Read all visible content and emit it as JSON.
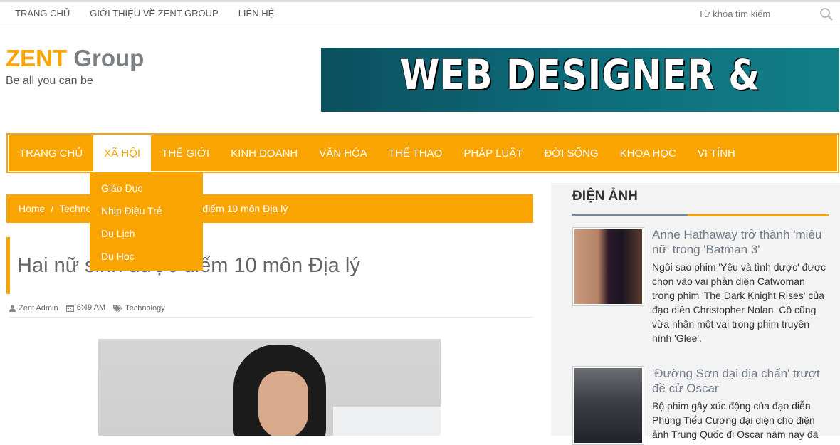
{
  "topbar": {
    "links": [
      "TRANG CHỦ",
      "GIỚI THIỆU VỀ ZENT GROUP",
      "LIÊN HỆ"
    ],
    "search_placeholder": "Từ khóa tìm kiếm"
  },
  "brand": {
    "logo_part1": "ZENT",
    "logo_part2": "Group",
    "tagline": "Be all you can be"
  },
  "banner": {
    "text": "WEB DESIGNER & DEVELOPER"
  },
  "mainnav": {
    "items": [
      "TRANG CHỦ",
      "XÃ HỘI",
      "THẾ GIỚI",
      "KINH DOANH",
      "VĂN HÓA",
      "THỂ THAO",
      "PHÁP LUẬT",
      "ĐỜI SỐNG",
      "KHOA HỌC",
      "VI TÍNH"
    ],
    "active_index": 1,
    "dropdown": [
      "Giáo Dục",
      "Nhịp Điệu Trẻ",
      "Du Lịch",
      "Du Học"
    ]
  },
  "breadcrumb": {
    "home": "Home",
    "category": "Technology",
    "current": "Hai nữ sinh được điểm 10 môn Địa lý",
    "visible_category": "Techno",
    "visible_current": "điểm 10 môn Địa lý"
  },
  "post": {
    "title": "Hai nữ sinh được điểm 10 môn Địa lý",
    "author": "Zent Admin",
    "time": "6:49 AM",
    "category": "Technology"
  },
  "sidebar": {
    "widget_title": "ĐIỆN ẢNH",
    "items": [
      {
        "title": "Anne Hathaway trở thành 'miêu nữ' trong 'Batman 3'",
        "desc": "Ngôi sao phim 'Yêu và tình dược' được chọn vào vai phản diện Catwoman trong phim 'The Dark Knight Rises' của đạo diễn Christopher Nolan. Cô cũng vừa nhận một vai trong phim truyền hình 'Glee'."
      },
      {
        "title": "'Đường Sơn đại địa chấn' trượt đề cử Oscar",
        "desc": "Bộ phim gây xúc động của đạo diễn Phùng Tiểu Cương đại diện cho điện ảnh Trung Quốc đi Oscar năm nay đã"
      }
    ]
  },
  "colors": {
    "accent": "#f9a400",
    "logo_gray": "#7a7f84",
    "title_gray": "#6f7a86"
  }
}
